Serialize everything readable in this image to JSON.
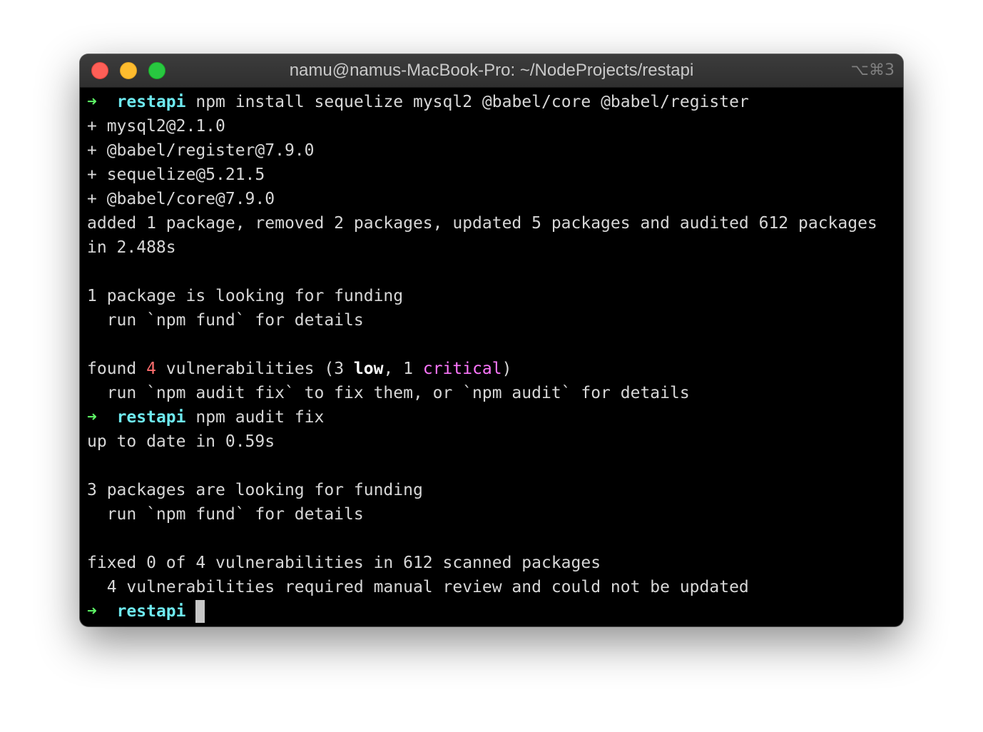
{
  "window": {
    "title": "namu@namus-MacBook-Pro: ~/NodeProjects/restapi",
    "shortcut": "⌥⌘3"
  },
  "terminal": {
    "prompt_arrow": "➜",
    "prompt_dir": "restapi",
    "cmd1": " npm install sequelize mysql2 @babel/core @babel/register",
    "out1": [
      "+ mysql2@2.1.0",
      "+ @babel/register@7.9.0",
      "+ sequelize@5.21.5",
      "+ @babel/core@7.9.0",
      "added 1 package, removed 2 packages, updated 5 packages and audited 612 packages",
      "in 2.488s",
      "",
      "1 package is looking for funding",
      "  run `npm fund` for details",
      ""
    ],
    "vuln": {
      "prefix": "found ",
      "count": "4",
      "mid": " vulnerabilities (3 ",
      "low": "low",
      "mid2": ", 1 ",
      "critical": "critical",
      "suffix": ")"
    },
    "out2": [
      "  run `npm audit fix` to fix them, or `npm audit` for details"
    ],
    "cmd2": " npm audit fix",
    "out3": [
      "up to date in 0.59s",
      "",
      "3 packages are looking for funding",
      "  run `npm fund` for details",
      "",
      "fixed 0 of 4 vulnerabilities in 612 scanned packages",
      "  4 vulnerabilities required manual review and could not be updated"
    ]
  }
}
